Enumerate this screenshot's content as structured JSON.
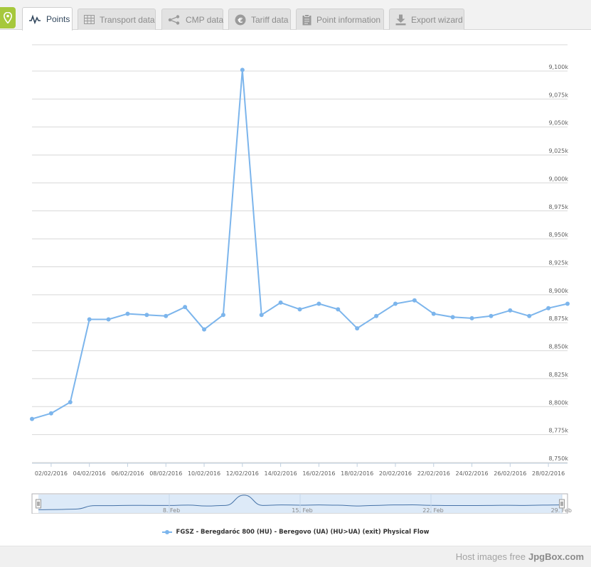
{
  "tabs": [
    {
      "label": "Points",
      "icon": "line-chart-icon",
      "active": true
    },
    {
      "label": "Transport data",
      "icon": "table-icon",
      "active": false
    },
    {
      "label": "CMP data",
      "icon": "share-nodes-icon",
      "active": false
    },
    {
      "label": "Tariff data",
      "icon": "euro-icon",
      "active": false
    },
    {
      "label": "Point information",
      "icon": "clipboard-icon",
      "active": false
    },
    {
      "label": "Export wizard",
      "icon": "download-icon",
      "active": false
    }
  ],
  "colors": {
    "series": "#7cb5ec",
    "pin_button": "#a6c83c",
    "navigator_fill": "#d9e8f7"
  },
  "chart_data": {
    "type": "line",
    "title": "",
    "xlabel": "",
    "ylabel": "",
    "x": [
      "01/02/2016",
      "02/02/2016",
      "03/02/2016",
      "04/02/2016",
      "05/02/2016",
      "06/02/2016",
      "07/02/2016",
      "08/02/2016",
      "09/02/2016",
      "10/02/2016",
      "11/02/2016",
      "12/02/2016",
      "13/02/2016",
      "14/02/2016",
      "15/02/2016",
      "16/02/2016",
      "17/02/2016",
      "18/02/2016",
      "19/02/2016",
      "20/02/2016",
      "21/02/2016",
      "22/02/2016",
      "23/02/2016",
      "24/02/2016",
      "25/02/2016",
      "26/02/2016",
      "27/02/2016",
      "28/02/2016",
      "29/02/2016"
    ],
    "series": [
      {
        "name": "FGSZ - Beregdaróc 800 (HU) - Beregovo (UA) (HU>UA) (exit) Physical Flow",
        "values": [
          8789,
          8794,
          8804,
          8878,
          8878,
          8883,
          8882,
          8881,
          8889,
          8869,
          8882,
          9101,
          8882,
          8893,
          8887,
          8892,
          8887,
          8870,
          8881,
          8892,
          8895,
          8883,
          8880,
          8879,
          8881,
          8886,
          8881,
          8888,
          8892
        ]
      }
    ],
    "ylim": [
      8750,
      9100
    ],
    "y_ticks": [
      "8,750k",
      "8,775k",
      "8,800k",
      "8,825k",
      "8,850k",
      "8,875k",
      "8,900k",
      "8,925k",
      "8,950k",
      "8,975k",
      "9,000k",
      "9,025k",
      "9,050k",
      "9,075k",
      "9,100k"
    ],
    "x_tick_labels": [
      "02/02/2016",
      "04/02/2016",
      "06/02/2016",
      "08/02/2016",
      "10/02/2016",
      "12/02/2016",
      "14/02/2016",
      "16/02/2016",
      "18/02/2016",
      "20/02/2016",
      "22/02/2016",
      "24/02/2016",
      "26/02/2016",
      "28/02/2016"
    ],
    "navigator_labels": [
      "8. Feb",
      "15. Feb",
      "22. Feb",
      "29. Feb"
    ],
    "grid": true,
    "legend": "bottom-center"
  },
  "footer": {
    "prefix": "Host images free",
    "brand": "JpgBox.com"
  }
}
